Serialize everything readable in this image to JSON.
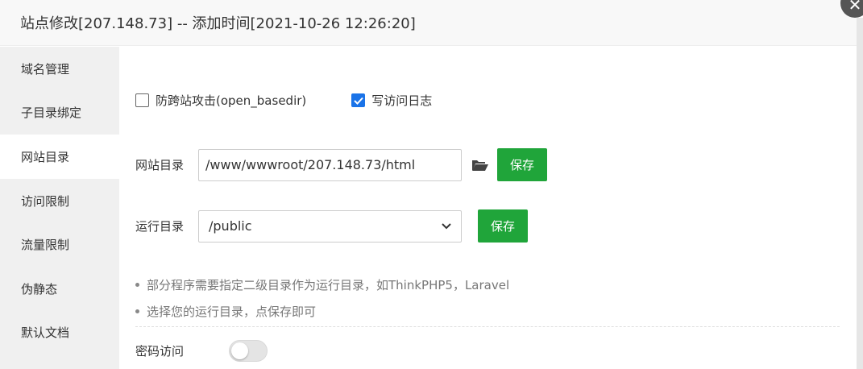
{
  "window": {
    "title": "站点修改[207.148.73] -- 添加时间[2021-10-26 12:26:20]"
  },
  "sidebar": {
    "items": [
      {
        "label": "域名管理"
      },
      {
        "label": "子目录绑定"
      },
      {
        "label": "网站目录",
        "active": true
      },
      {
        "label": "访问限制"
      },
      {
        "label": "流量限制"
      },
      {
        "label": "伪静态"
      },
      {
        "label": "默认文档"
      }
    ]
  },
  "options": {
    "anti_xss_label": "防跨站攻击(open_basedir)",
    "anti_xss_checked": false,
    "access_log_label": "写访问日志",
    "access_log_checked": true
  },
  "site_dir": {
    "label": "网站目录",
    "value": "/www/wwwroot/207.148.73/html",
    "save_label": "保存"
  },
  "run_dir": {
    "label": "运行目录",
    "value": "/public",
    "save_label": "保存"
  },
  "tips": [
    "部分程序需要指定二级目录作为运行目录，如ThinkPHP5，Laravel",
    "选择您的运行目录，点保存即可"
  ],
  "password_access": {
    "label": "密码访问",
    "enabled": false
  },
  "colors": {
    "accent_green": "#20a53a",
    "checkbox_blue": "#1a73e8",
    "sidebar_bg": "#f0f0f0"
  }
}
